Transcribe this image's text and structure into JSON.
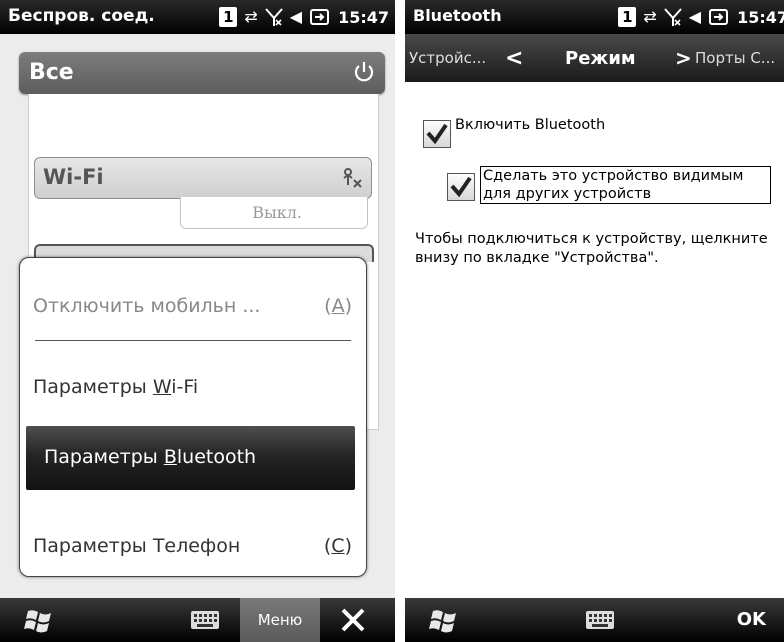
{
  "left_screen": {
    "status_title": "Беспров. соед.",
    "clock": "15:47",
    "sim_badge": "1",
    "group_all_label": "Все",
    "wifi_label": "Wi-Fi",
    "wifi_status": "Выкл.",
    "menu": {
      "mobile": {
        "text": "Отключить мобильн ...",
        "accel_open": "(",
        "accel_char": "А",
        "accel_close": ")"
      },
      "wifi": {
        "prefix": "Параметры ",
        "accel_char": "W",
        "suffix": "i-Fi"
      },
      "bluetooth": {
        "prefix": "Параметры ",
        "accel_char": "B",
        "suffix": "luetooth"
      },
      "phone": {
        "text": "Параметры Телефон",
        "accel_open": "(",
        "accel_char": "С",
        "accel_close": ")"
      }
    },
    "bottom": {
      "menu_label": "Меню"
    }
  },
  "right_screen": {
    "status_title": "Bluetooth",
    "clock": "15:47",
    "sim_badge": "1",
    "tabs": {
      "left": "Устройс...",
      "current": "Режим",
      "right": "Порты С..."
    },
    "enable_bluetooth": {
      "label": "Включить Bluetooth",
      "checked": true
    },
    "visible": {
      "label": "Сделать это устройство видимым для других устройств",
      "checked": true
    },
    "hint": "Чтобы подключиться к устройству, щелкните внизу по вкладке \"Устройства\".",
    "bottom": {
      "ok_label": "OK"
    }
  }
}
